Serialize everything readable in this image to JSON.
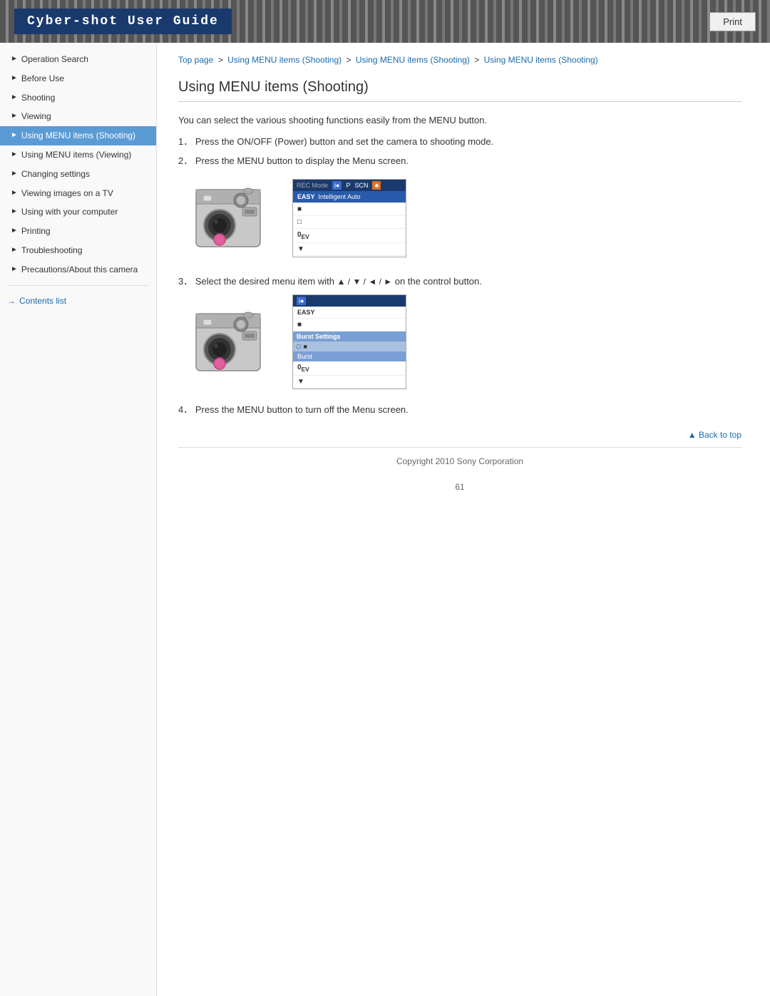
{
  "header": {
    "title": "Cyber-shot User Guide",
    "print_label": "Print"
  },
  "breadcrumb": {
    "top": "Top page",
    "part1": "Using MENU items (Shooting)",
    "part2": "Using MENU items (Shooting)",
    "part3": "Using MENU items (Shooting)"
  },
  "sidebar": {
    "items": [
      {
        "id": "operation-search",
        "label": "Operation Search",
        "active": false
      },
      {
        "id": "before-use",
        "label": "Before Use",
        "active": false
      },
      {
        "id": "shooting",
        "label": "Shooting",
        "active": false
      },
      {
        "id": "viewing",
        "label": "Viewing",
        "active": false
      },
      {
        "id": "using-menu-shooting",
        "label": "Using MENU items (Shooting)",
        "active": true
      },
      {
        "id": "using-menu-viewing",
        "label": "Using MENU items (Viewing)",
        "active": false
      },
      {
        "id": "changing-settings",
        "label": "Changing settings",
        "active": false
      },
      {
        "id": "viewing-tv",
        "label": "Viewing images on a TV",
        "active": false
      },
      {
        "id": "using-computer",
        "label": "Using with your computer",
        "active": false
      },
      {
        "id": "printing",
        "label": "Printing",
        "active": false
      },
      {
        "id": "troubleshooting",
        "label": "Troubleshooting",
        "active": false
      },
      {
        "id": "precautions",
        "label": "Precautions/About this camera",
        "active": false
      }
    ],
    "contents_link": "Contents list"
  },
  "page": {
    "title": "Using MENU items (Shooting)",
    "intro": "You can select the various shooting functions easily from the MENU button.",
    "steps": [
      {
        "num": "1",
        "text": "Press the ON/OFF (Power) button and set the camera to shooting mode."
      },
      {
        "num": "2",
        "text": "Press the MENU button to display the Menu screen."
      },
      {
        "num": "3",
        "text": "Select the desired menu item with"
      },
      {
        "num": "4",
        "text": "Press the MENU button to turn off the Menu screen."
      }
    ],
    "step3_symbols": "▲ / ▼ / ◄ / ►",
    "step3_suffix": "on the control button.",
    "back_to_top": "▲ Back to top",
    "copyright": "Copyright 2010 Sony Corporation",
    "page_number": "61"
  }
}
